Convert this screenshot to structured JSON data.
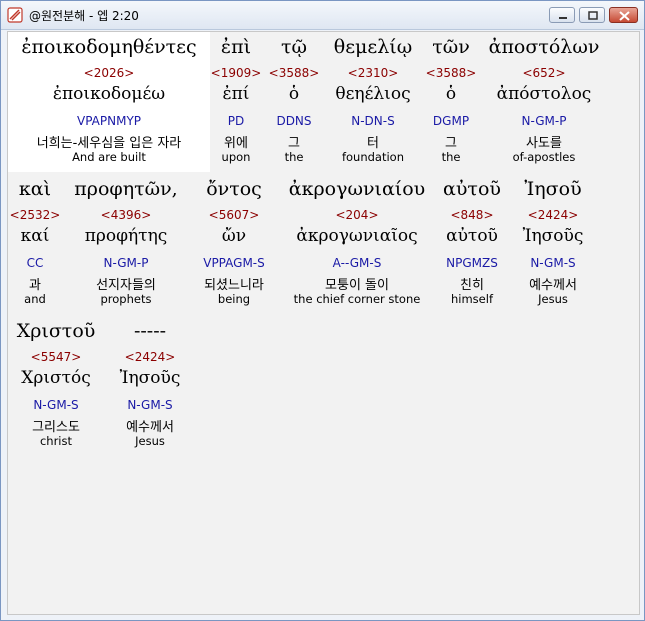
{
  "window": {
    "title": "@원전분해 - 엡 2:20"
  },
  "words": [
    {
      "greek": "ἐποικοδομηθέντες",
      "strong": "<2026>",
      "lemma": "ἐποικοδομέω",
      "parse": "VPAPNMYP",
      "korean": "너희는-세우심을 입은 자라",
      "english": "And are built",
      "highlight": true
    },
    {
      "greek": "ἐπὶ",
      "strong": "<1909>",
      "lemma": "ἐπί",
      "parse": "PD",
      "korean": "위에",
      "english": "upon"
    },
    {
      "greek": "τῷ",
      "strong": "<3588>",
      "lemma": "ὁ",
      "parse": "DDNS",
      "korean": "그",
      "english": "the"
    },
    {
      "greek": "θεμελίῳ",
      "strong": "<2310>",
      "lemma": "θεηέλιος",
      "parse": "N-DN-S",
      "korean": "터",
      "english": "foundation"
    },
    {
      "greek": "τῶν",
      "strong": "<3588>",
      "lemma": "ὁ",
      "parse": "DGMP",
      "korean": "그",
      "english": "the"
    },
    {
      "greek": "ἀποστόλων",
      "strong": "<652>",
      "lemma": "ἀπόστολος",
      "parse": "N-GM-P",
      "korean": "사도를",
      "english": "of-apostles"
    },
    {
      "greek": "καὶ",
      "strong": "<2532>",
      "lemma": "καί",
      "parse": "CC",
      "korean": "과",
      "english": "and"
    },
    {
      "greek": "προφητῶν,",
      "strong": "<4396>",
      "lemma": "προφήτης",
      "parse": "N-GM-P",
      "korean": "선지자들의",
      "english": "prophets"
    },
    {
      "greek": "ὄντος",
      "strong": "<5607>",
      "lemma": "ὤν",
      "parse": "VPPAGM-S",
      "korean": "되셨느니라",
      "english": "being"
    },
    {
      "greek": "ἀκρογωνιαίου",
      "strong": "<204>",
      "lemma": "ἀκρογωνιαῖος",
      "parse": "A--GM-S",
      "korean": "모퉁이 돌이",
      "english": "the chief corner stone"
    },
    {
      "greek": "αὐτοῦ",
      "strong": "<848>",
      "lemma": "αὐτοῦ",
      "parse": "NPGMZS",
      "korean": "친히",
      "english": "himself"
    },
    {
      "greek": "Ἰησοῦ",
      "strong": "<2424>",
      "lemma": "Ἰησοῦς",
      "parse": "N-GM-S",
      "korean": "예수께서",
      "english": "Jesus"
    },
    {
      "greek": "Χριστοῦ",
      "strong": "<5547>",
      "lemma": "Χριστός",
      "parse": "N-GM-S",
      "korean": "그리스도",
      "english": "christ"
    },
    {
      "greek": "-----",
      "strong": "<2424>",
      "lemma": "Ἰησοῦς",
      "parse": "N-GM-S",
      "korean": "예수께서",
      "english": "Jesus"
    }
  ]
}
